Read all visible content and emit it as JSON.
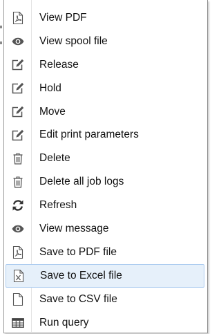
{
  "context_menu": {
    "items": [
      {
        "label": "View PDF",
        "icon": "pdf-file-icon"
      },
      {
        "label": "View spool file",
        "icon": "eye-icon"
      },
      {
        "label": "Release",
        "icon": "edit-icon"
      },
      {
        "label": "Hold",
        "icon": "edit-icon"
      },
      {
        "label": "Move",
        "icon": "edit-icon"
      },
      {
        "label": "Edit print parameters",
        "icon": "edit-icon"
      },
      {
        "label": "Delete",
        "icon": "trash-icon"
      },
      {
        "label": "Delete all job logs",
        "icon": "trash-icon"
      },
      {
        "label": "Refresh",
        "icon": "refresh-icon"
      },
      {
        "label": "View message",
        "icon": "eye-icon"
      },
      {
        "label": "Save to PDF file",
        "icon": "pdf-file-icon"
      },
      {
        "label": "Save to Excel file",
        "icon": "excel-file-icon"
      },
      {
        "label": "Save to CSV file",
        "icon": "blank-file-icon"
      },
      {
        "label": "Run query",
        "icon": "table-icon"
      }
    ],
    "hovered_item": "Save to Excel file",
    "colors": {
      "hover_background": "#e6f0fa",
      "hover_border": "#aecdf0",
      "text": "#111111",
      "icon": "#555555"
    }
  }
}
